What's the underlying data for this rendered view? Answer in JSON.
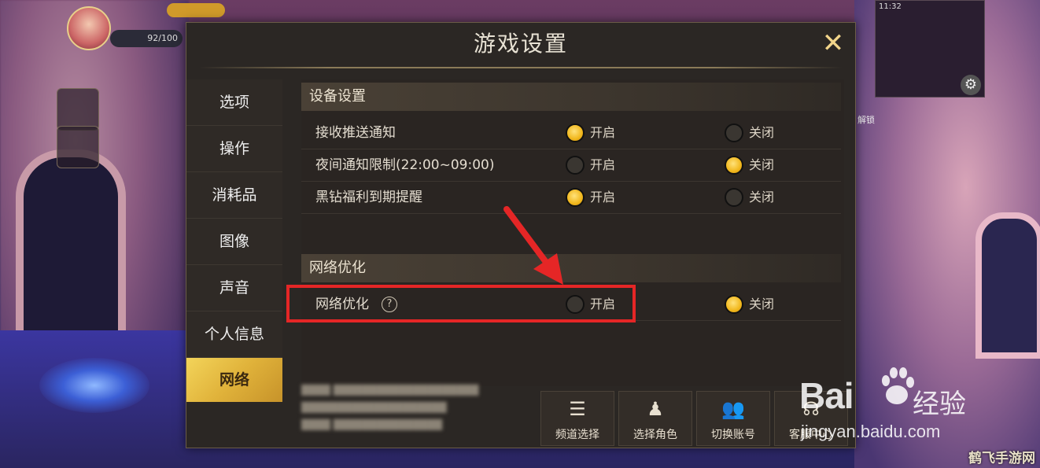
{
  "dialog": {
    "title": "游戏设置",
    "close_icon": "close-icon"
  },
  "nav": {
    "items": [
      {
        "label": "选项"
      },
      {
        "label": "操作"
      },
      {
        "label": "消耗品"
      },
      {
        "label": "图像"
      },
      {
        "label": "声音"
      },
      {
        "label": "个人信息"
      },
      {
        "label": "网络"
      }
    ],
    "active": "网络"
  },
  "sections": {
    "device": {
      "header": "设备设置",
      "rows": [
        {
          "label": "接收推送通知",
          "on_label": "开启",
          "off_label": "关闭",
          "selected": "on"
        },
        {
          "label": "夜间通知限制(22:00~09:00)",
          "on_label": "开启",
          "off_label": "关闭",
          "selected": "off"
        },
        {
          "label": "黑钻福利到期提醒",
          "on_label": "开启",
          "off_label": "关闭",
          "selected": "on"
        }
      ]
    },
    "network": {
      "header": "网络优化",
      "rows": [
        {
          "label": "网络优化",
          "help": "?",
          "on_label": "开启",
          "off_label": "关闭",
          "selected": "off"
        }
      ]
    }
  },
  "bottom_buttons": [
    {
      "label": "频道选择",
      "icon": "list-icon"
    },
    {
      "label": "选择角色",
      "icon": "character-icon"
    },
    {
      "label": "切换账号",
      "icon": "users-icon"
    },
    {
      "label": "客服中心",
      "icon": "headset-icon"
    }
  ],
  "hud": {
    "hp_text": "92/100",
    "status_time": "11:32",
    "unlock_label": "解锁"
  },
  "watermark": {
    "brand": "Bai",
    "brand_suffix": "du",
    "cn": "经验",
    "url": "jingyan.baidu.com",
    "corner": "鹤飞手游网"
  },
  "colors": {
    "accent_gold": "#f1b71c",
    "highlight_red": "#e52626",
    "panel_bg": "#2b2724"
  }
}
